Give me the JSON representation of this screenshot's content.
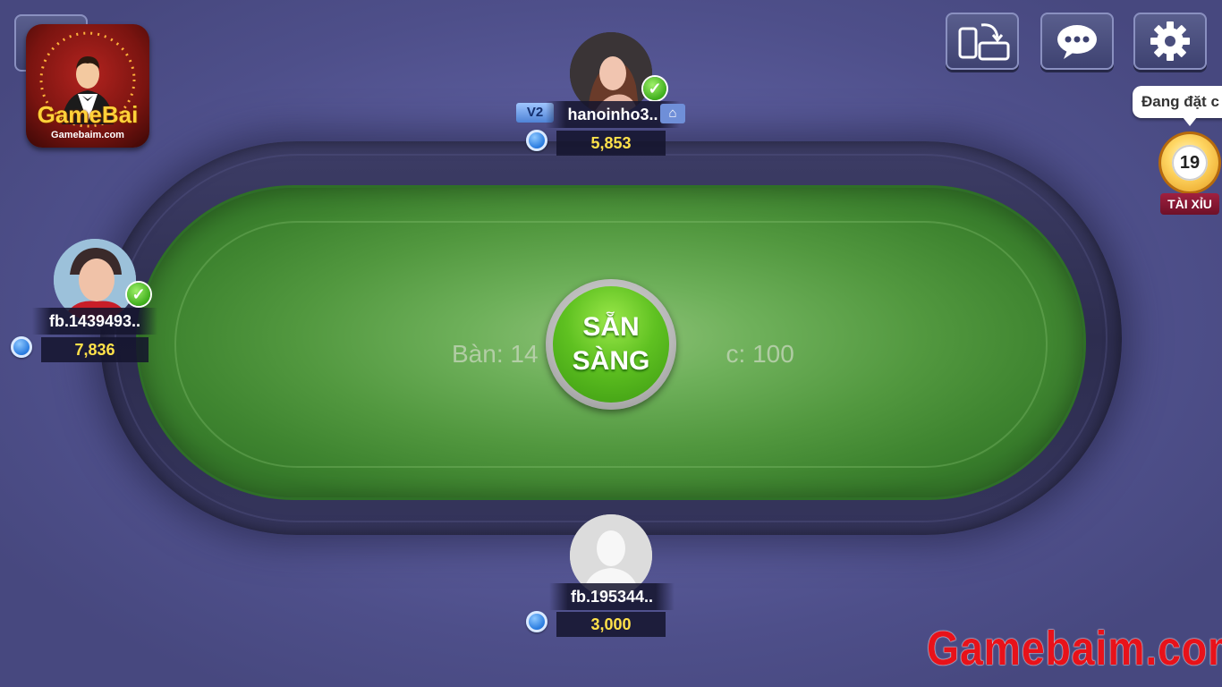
{
  "table": {
    "table_label": "Bàn: 14",
    "bet_label": "c: 100",
    "ready_line1": "SẴN",
    "ready_line2": "SÀNG"
  },
  "players": {
    "top": {
      "vip": "V2",
      "name": "hanoinho3..",
      "chips": "5,853",
      "ready": true
    },
    "left": {
      "name": "fb.1439493..",
      "chips": "7,836",
      "ready": true
    },
    "bottom": {
      "name": "fb.195344..",
      "chips": "3,000",
      "ready": false
    }
  },
  "toolbar": {
    "rotate_icon": "rotate-device-icon",
    "chat_icon": "chat-bubble-icon",
    "settings_icon": "gear-icon"
  },
  "taixiu": {
    "bubble_text": "Đang đặt c",
    "countdown": "19",
    "label": "TÀI XỈU"
  },
  "logo": {
    "brand": "GameBai",
    "site": "Gamebaim.com"
  },
  "watermark": "Gamebaim.com",
  "colors": {
    "felt": "#52983f",
    "chips_text": "#ffe14a",
    "watermark": "#e8121a",
    "background": "#5b5c9c"
  }
}
